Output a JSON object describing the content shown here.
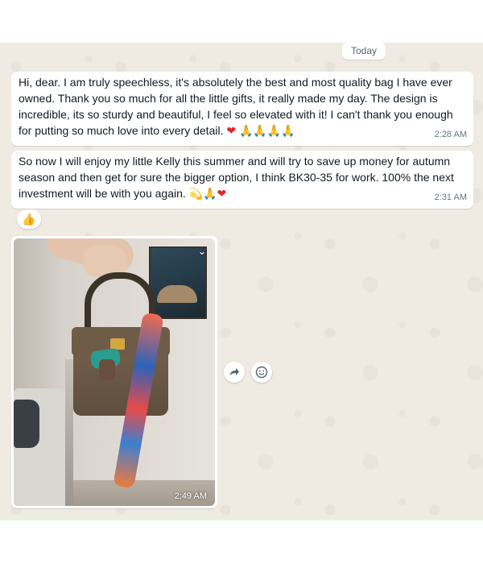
{
  "date_chip": "Today",
  "messages": [
    {
      "text": "Hi, dear. I am truly speechless, it's absolutely the best and most quality bag I have ever owned. Thank you so much for all the little gifts, it really made my day. The design is incredible, its so sturdy and beautiful, I feel so elevated with it! I can't thank you enough for putting so much love into every detail.",
      "emojis": [
        "❤",
        "🙏🙏🙏🙏"
      ],
      "time": "2:28 AM"
    },
    {
      "text": "So now I will enjoy my little Kelly this summer and will try to save up money for autumn season and then get for sure the bigger option, I think BK30-35 for work. 100% the next investment will be with you again.",
      "emojis": [
        "💫",
        "🙏",
        "❤"
      ],
      "time": "2:31 AM"
    }
  ],
  "reaction": "👍",
  "image_message": {
    "time": "2:49 AM",
    "chevron_icon": "chevron-down-icon"
  },
  "actions": {
    "forward_icon": "forward-icon",
    "emoji_icon": "smiley-icon"
  },
  "colors": {
    "chat_bg": "#efeae2",
    "bubble_bg": "#ffffff",
    "timestamp": "#667781"
  }
}
